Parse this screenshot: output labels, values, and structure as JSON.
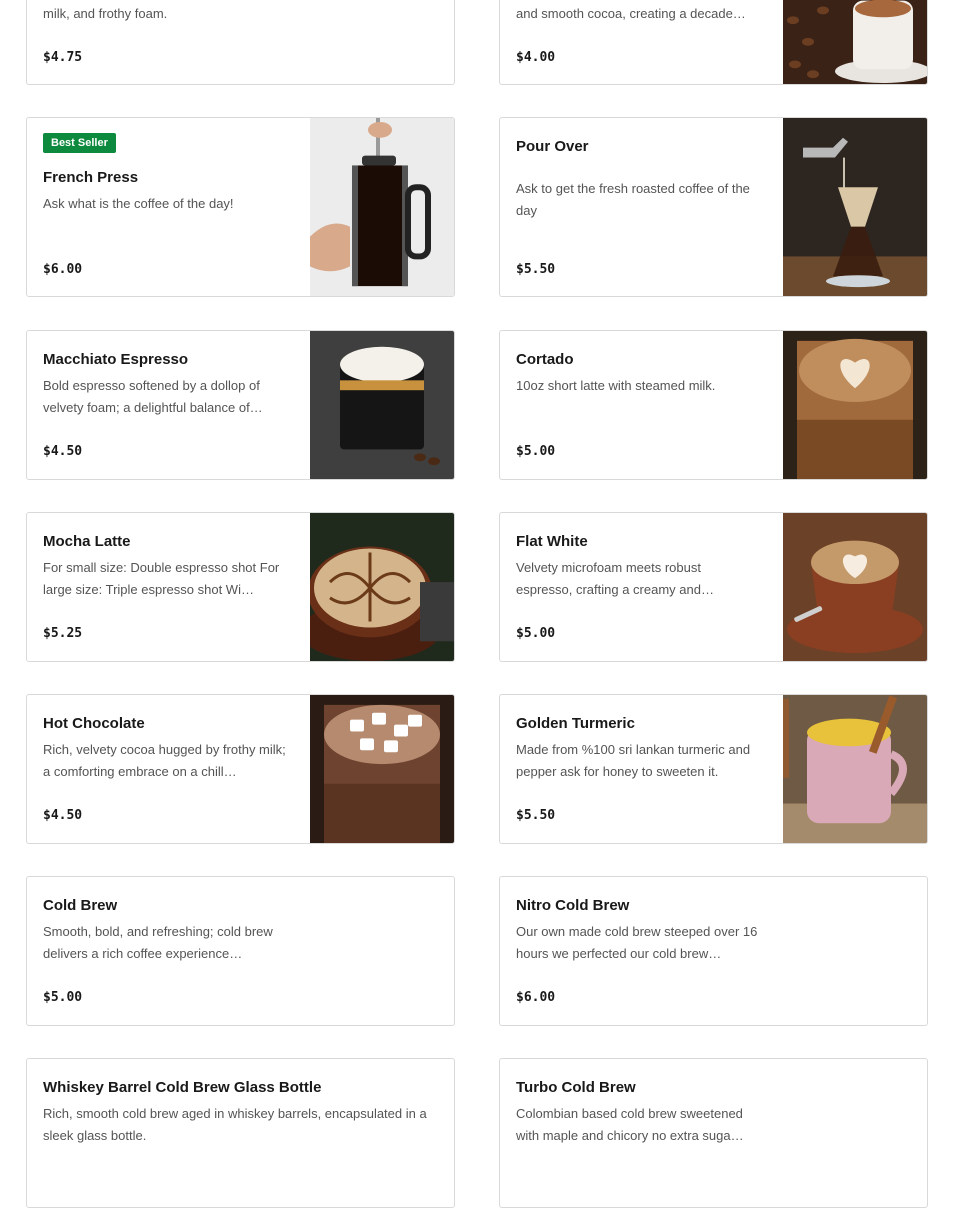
{
  "items": [
    {
      "id": "latte-partial",
      "title": "",
      "desc": "milk, and frothy foam.",
      "price": "$4.75",
      "badge": ""
    },
    {
      "id": "cocoa-partial",
      "title": "",
      "desc": "and smooth cocoa, creating a decade…",
      "price": "$4.00",
      "badge": ""
    },
    {
      "id": "french-press",
      "title": "French Press",
      "desc": "Ask what is the coffee of the day!",
      "price": "$6.00",
      "badge": "Best Seller"
    },
    {
      "id": "pour-over",
      "title": "Pour Over",
      "desc": "Ask to get the fresh roasted coffee of the day",
      "price": "$5.50",
      "badge": ""
    },
    {
      "id": "macchiato",
      "title": "Macchiato Espresso",
      "desc": "Bold espresso softened by a dollop of velvety foam; a delightful balance of…",
      "price": "$4.50",
      "badge": ""
    },
    {
      "id": "cortado",
      "title": "Cortado",
      "desc": "10oz short latte with steamed milk.",
      "price": "$5.00",
      "badge": ""
    },
    {
      "id": "mocha-latte",
      "title": "Mocha Latte",
      "desc": "For small size: Double espresso shot For large size: Triple espresso shot Wi…",
      "price": "$5.25",
      "badge": ""
    },
    {
      "id": "flat-white",
      "title": "Flat White",
      "desc": "Velvety microfoam meets robust espresso, crafting a creamy and…",
      "price": "$5.00",
      "badge": ""
    },
    {
      "id": "hot-chocolate",
      "title": "Hot Chocolate",
      "desc": "Rich, velvety cocoa hugged by frothy milk; a comforting embrace on a chill…",
      "price": "$4.50",
      "badge": ""
    },
    {
      "id": "golden-turmeric",
      "title": "Golden Turmeric",
      "desc": "Made from %100 sri lankan turmeric and pepper ask for honey to sweeten it.",
      "price": "$5.50",
      "badge": ""
    },
    {
      "id": "cold-brew",
      "title": "Cold Brew",
      "desc": "Smooth, bold, and refreshing; cold brew delivers a rich coffee experience…",
      "price": "$5.00",
      "badge": ""
    },
    {
      "id": "nitro-cold-brew",
      "title": "Nitro Cold Brew",
      "desc": "Our own made cold brew steeped over 16 hours we perfected our cold brew…",
      "price": "$6.00",
      "badge": ""
    },
    {
      "id": "whiskey-barrel",
      "title": "Whiskey Barrel Cold Brew Glass Bottle",
      "desc": "Rich, smooth cold brew aged in whiskey barrels, encapsulated in a sleek glass bottle.",
      "price": "",
      "badge": ""
    },
    {
      "id": "turbo-cold-brew",
      "title": "Turbo Cold Brew",
      "desc": "Colombian based cold brew sweetened with maple and chicory no extra suga…",
      "price": "",
      "badge": ""
    }
  ],
  "colors": {
    "badge": "#0e8a3e",
    "border": "#d9d9d9",
    "title": "#191919",
    "desc": "#545454"
  },
  "photos": [
    "coffee-beans-cup-photo",
    "french-press-photo",
    "pour-over-photo",
    "macchiato-photo",
    "cortado-photo",
    "mocha-latte-photo",
    "flat-white-photo",
    "hot-chocolate-photo",
    "golden-turmeric-photo"
  ]
}
